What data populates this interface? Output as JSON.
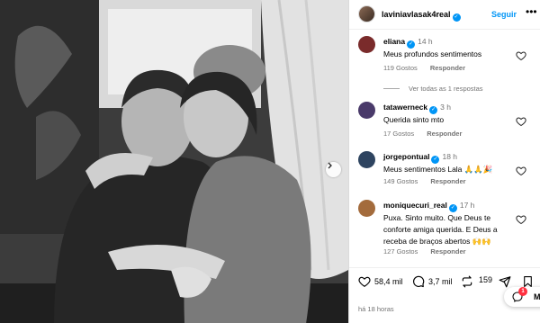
{
  "post": {
    "username": "laviniavlasak4real",
    "follow_label": "Seguir",
    "more_label": "•••"
  },
  "comments": [
    {
      "username": "eliana",
      "time": "14 h",
      "text": "Meus profundos sentimentos",
      "likes": "119 Gostos",
      "reply": "Responder",
      "avatar_color": "#7a2b2b"
    },
    {
      "username": "tatawerneck",
      "time": "3 h",
      "text": "Querida sinto mto",
      "likes": "17 Gostos",
      "reply": "Responder",
      "avatar_color": "#4a3a6a"
    },
    {
      "username": "jorgepontual",
      "time": "18 h",
      "text": "Meus sentimentos Lala 🙏🙏🎉",
      "likes": "149 Gostos",
      "reply": "Responder",
      "avatar_color": "#2e4460"
    },
    {
      "username": "moniquecuri_real",
      "time": "17 h",
      "text": "Puxa. Sinto muito. Que Deus te conforte amiga querida. E Deus a receba de braços abertos 🙌🙌",
      "likes": "127 Gostos",
      "reply": "Responder",
      "avatar_color": "#a36b3c"
    }
  ],
  "view_replies": "Ver todas as 1 respostas",
  "actions": {
    "likes": "58,4 mil",
    "comments": "3,7 mil",
    "shares": "159"
  },
  "time_ago": "há 18 horas",
  "messages_fab": {
    "badge": "1",
    "label": "M"
  },
  "colors": {
    "accent": "#0095f6",
    "badge": "#ff3040",
    "muted": "#737373"
  },
  "icons": [
    "chevron-right-icon",
    "verified-icon",
    "heart-icon",
    "comment-icon",
    "repost-icon",
    "send-icon",
    "bookmark-icon",
    "message-icon"
  ]
}
